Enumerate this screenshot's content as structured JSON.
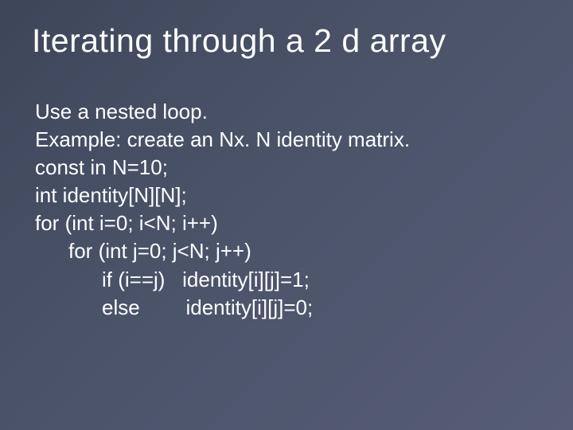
{
  "slide": {
    "title": "Iterating through a 2 d array",
    "lines": [
      {
        "text": "Use a nested loop.",
        "indent": 0
      },
      {
        "text": "Example: create an Nx. N identity matrix.",
        "indent": 0
      },
      {
        "text": "const in N=10;",
        "indent": 0
      },
      {
        "text": "int identity[N][N];",
        "indent": 0
      },
      {
        "text": "for (int i=0; i<N; i++)",
        "indent": 0
      },
      {
        "text": "for (int j=0; j<N; j++)",
        "indent": 1
      },
      {
        "text": "if (i==j)   identity[i][j]=1;",
        "indent": 2
      },
      {
        "text": "else        identity[i][j]=0;",
        "indent": 2
      }
    ]
  }
}
